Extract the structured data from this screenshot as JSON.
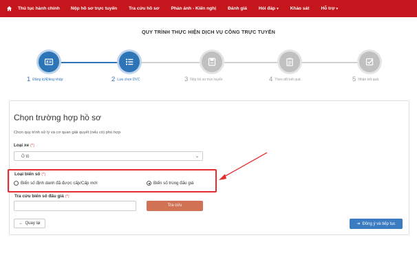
{
  "nav": {
    "items": [
      {
        "label": "Thủ tục hành chính",
        "dropdown": false
      },
      {
        "label": "Nộp hồ sơ trực tuyến",
        "dropdown": false
      },
      {
        "label": "Tra cứu hồ sơ",
        "dropdown": false
      },
      {
        "label": "Phản ánh - Kiến nghị",
        "dropdown": false
      },
      {
        "label": "Đánh giá",
        "dropdown": false
      },
      {
        "label": "Hỏi đáp",
        "dropdown": true
      },
      {
        "label": "Khảo sát",
        "dropdown": false
      },
      {
        "label": "Hỗ trợ",
        "dropdown": true
      }
    ],
    "caret": "▾"
  },
  "page_title": "QUY TRÌNH THỰC HIỆN DỊCH VỤ CÔNG TRỰC TUYẾN",
  "steps": [
    {
      "num": "1",
      "label": "Đăng ký/Đăng nhập",
      "state": "done",
      "icon": "id-card-icon"
    },
    {
      "num": "2",
      "label": "Lựa chọn DVC",
      "state": "done",
      "icon": "list-icon"
    },
    {
      "num": "3",
      "label": "Nộp hồ sơ trực tuyến",
      "state": "todo",
      "icon": "save-icon"
    },
    {
      "num": "4",
      "label": "Theo dõi kết quả",
      "state": "todo",
      "icon": "clipboard-icon"
    },
    {
      "num": "5",
      "label": "Nhận kết quả",
      "state": "todo",
      "icon": "check-icon"
    }
  ],
  "form": {
    "title": "Chọn trường hợp hồ sơ",
    "description": "Chọn quy trình xử lý và cơ quan giải quyết (nếu có) phù hợp",
    "vehicle": {
      "label": "Loại xe",
      "required_mark": "(*)",
      "value": "Ô tô"
    },
    "plate": {
      "label": "Loại biển số",
      "required_mark": "(*)",
      "options": [
        {
          "label": "Biển số định danh đã được cấp/Cấp mới",
          "selected": false
        },
        {
          "label": "Biển số trúng đấu giá",
          "selected": true
        }
      ]
    },
    "lookup": {
      "label": "Tra cứu biển số đấu giá",
      "required_mark": "(*)",
      "value": "",
      "button": "Tra cứu"
    },
    "back_button": "Quay lại",
    "next_button": "Đồng ý và tiếp tục"
  },
  "colors": {
    "nav": "#c4161c",
    "primary": "#2d75b7",
    "search_button": "#d07253",
    "highlight": "#e52b2b"
  }
}
